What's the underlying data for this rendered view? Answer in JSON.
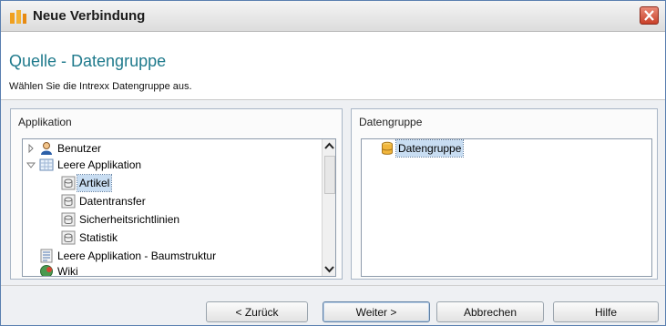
{
  "window": {
    "title": "Neue Verbindung"
  },
  "header": {
    "heading": "Quelle - Datengruppe",
    "subheading": "Wählen Sie die Intrexx Datengruppe aus."
  },
  "left_panel": {
    "label": "Applikation",
    "items": [
      {
        "label": "Benutzer",
        "icon": "user-icon"
      },
      {
        "label": "Leere Applikation",
        "icon": "table-icon"
      },
      {
        "label": "Artikel",
        "icon": "datagroup-icon",
        "selected": true
      },
      {
        "label": "Datentransfer",
        "icon": "datagroup-icon"
      },
      {
        "label": "Sicherheitsrichtlinien",
        "icon": "datagroup-icon"
      },
      {
        "label": "Statistik",
        "icon": "datagroup-icon"
      },
      {
        "label": "Leere Applikation - Baumstruktur",
        "icon": "tree-app-icon"
      },
      {
        "label": "Wiki",
        "icon": "globe-icon"
      }
    ]
  },
  "right_panel": {
    "label": "Datengruppe",
    "items": [
      {
        "label": "Datengruppe",
        "icon": "database-icon",
        "selected": true
      }
    ]
  },
  "buttons": {
    "back": "< Zurück",
    "next": "Weiter >",
    "cancel": "Abbrechen",
    "help": "Hilfe"
  }
}
